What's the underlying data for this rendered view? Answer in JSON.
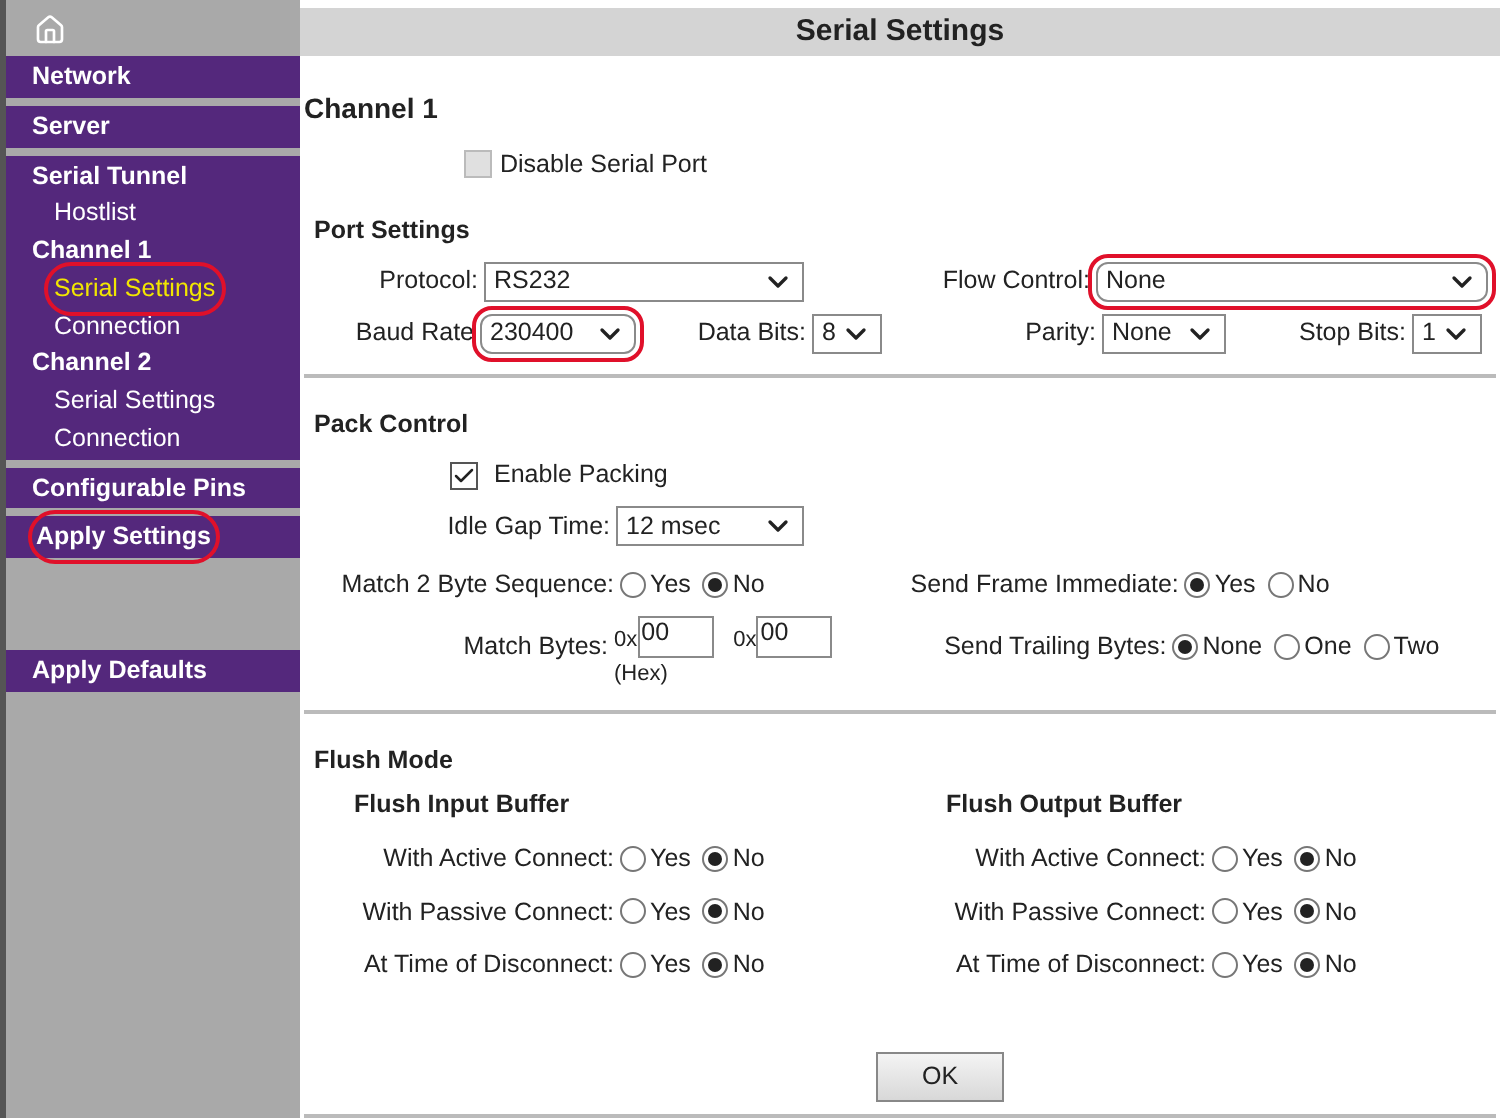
{
  "title": "Serial Settings",
  "sidebar": {
    "items": [
      {
        "label": "Network",
        "highlighted": false
      },
      {
        "label": "Server",
        "highlighted": false
      },
      {
        "label": "Serial Tunnel",
        "highlighted": false,
        "children": [
          {
            "label": "Hostlist",
            "selected": false,
            "highlighted": false
          },
          {
            "label": "Channel 1",
            "highlighted": false,
            "children": [
              {
                "label": "Serial Settings",
                "selected": true,
                "highlighted": true
              },
              {
                "label": "Connection",
                "selected": false,
                "highlighted": false
              }
            ]
          },
          {
            "label": "Channel 2",
            "highlighted": false,
            "children": [
              {
                "label": "Serial Settings",
                "selected": false,
                "highlighted": false
              },
              {
                "label": "Connection",
                "selected": false,
                "highlighted": false
              }
            ]
          }
        ]
      },
      {
        "label": "Configurable Pins",
        "highlighted": false
      },
      {
        "label": "Apply Settings",
        "highlighted": true
      },
      {
        "label": "Apply Defaults",
        "highlighted": false
      }
    ]
  },
  "channel_title": "Channel 1",
  "disable_serial_port": {
    "label": "Disable Serial Port",
    "checked": false,
    "disabled": true
  },
  "port_settings": {
    "heading": "Port Settings",
    "protocol": {
      "label": "Protocol:",
      "value": "RS232",
      "highlighted": false
    },
    "flow_control": {
      "label": "Flow Control:",
      "value": "None",
      "highlighted": true
    },
    "baud_rate": {
      "label": "Baud Rate",
      "value": "230400",
      "highlighted": true
    },
    "data_bits": {
      "label": "Data Bits:",
      "value": "8",
      "highlighted": false
    },
    "parity": {
      "label": "Parity:",
      "value": "None",
      "highlighted": false
    },
    "stop_bits": {
      "label": "Stop Bits:",
      "value": "1",
      "highlighted": false
    }
  },
  "pack_control": {
    "heading": "Pack Control",
    "enable_packing": {
      "label": "Enable Packing",
      "checked": true
    },
    "idle_gap_time": {
      "label": "Idle Gap Time:",
      "value": "12 msec",
      "highlighted": false
    },
    "match_2_byte_sequence": {
      "label": "Match 2 Byte Sequence:",
      "options": [
        {
          "label": "Yes",
          "selected": false
        },
        {
          "label": "No",
          "selected": true
        }
      ]
    },
    "send_frame_immediate": {
      "label": "Send Frame Immediate:",
      "options": [
        {
          "label": "Yes",
          "selected": true
        },
        {
          "label": "No",
          "selected": false
        }
      ]
    },
    "match_bytes": {
      "label": "Match Bytes:",
      "prefix_1": "0x",
      "value_1": "00",
      "prefix_2": "0x",
      "value_2": "00",
      "note": "(Hex)"
    },
    "send_trailing_bytes": {
      "label": "Send Trailing Bytes:",
      "options": [
        {
          "label": "None",
          "selected": true
        },
        {
          "label": "One",
          "selected": false
        },
        {
          "label": "Two",
          "selected": false
        }
      ]
    }
  },
  "flush_mode": {
    "heading": "Flush Mode",
    "groups": [
      {
        "title": "Flush Input Buffer",
        "rows": [
          {
            "label": "With Active Connect:",
            "options": [
              {
                "label": "Yes",
                "selected": false
              },
              {
                "label": "No",
                "selected": true
              }
            ]
          },
          {
            "label": "With Passive Connect:",
            "options": [
              {
                "label": "Yes",
                "selected": false
              },
              {
                "label": "No",
                "selected": true
              }
            ]
          },
          {
            "label": "At Time of Disconnect:",
            "options": [
              {
                "label": "Yes",
                "selected": false
              },
              {
                "label": "No",
                "selected": true
              }
            ]
          }
        ]
      },
      {
        "title": "Flush Output Buffer",
        "rows": [
          {
            "label": "With Active Connect:",
            "options": [
              {
                "label": "Yes",
                "selected": false
              },
              {
                "label": "No",
                "selected": true
              }
            ]
          },
          {
            "label": "With Passive Connect:",
            "options": [
              {
                "label": "Yes",
                "selected": false
              },
              {
                "label": "No",
                "selected": true
              }
            ]
          },
          {
            "label": "At Time of Disconnect:",
            "options": [
              {
                "label": "Yes",
                "selected": false
              },
              {
                "label": "No",
                "selected": true
              }
            ]
          }
        ]
      }
    ]
  },
  "ok_button": "OK"
}
